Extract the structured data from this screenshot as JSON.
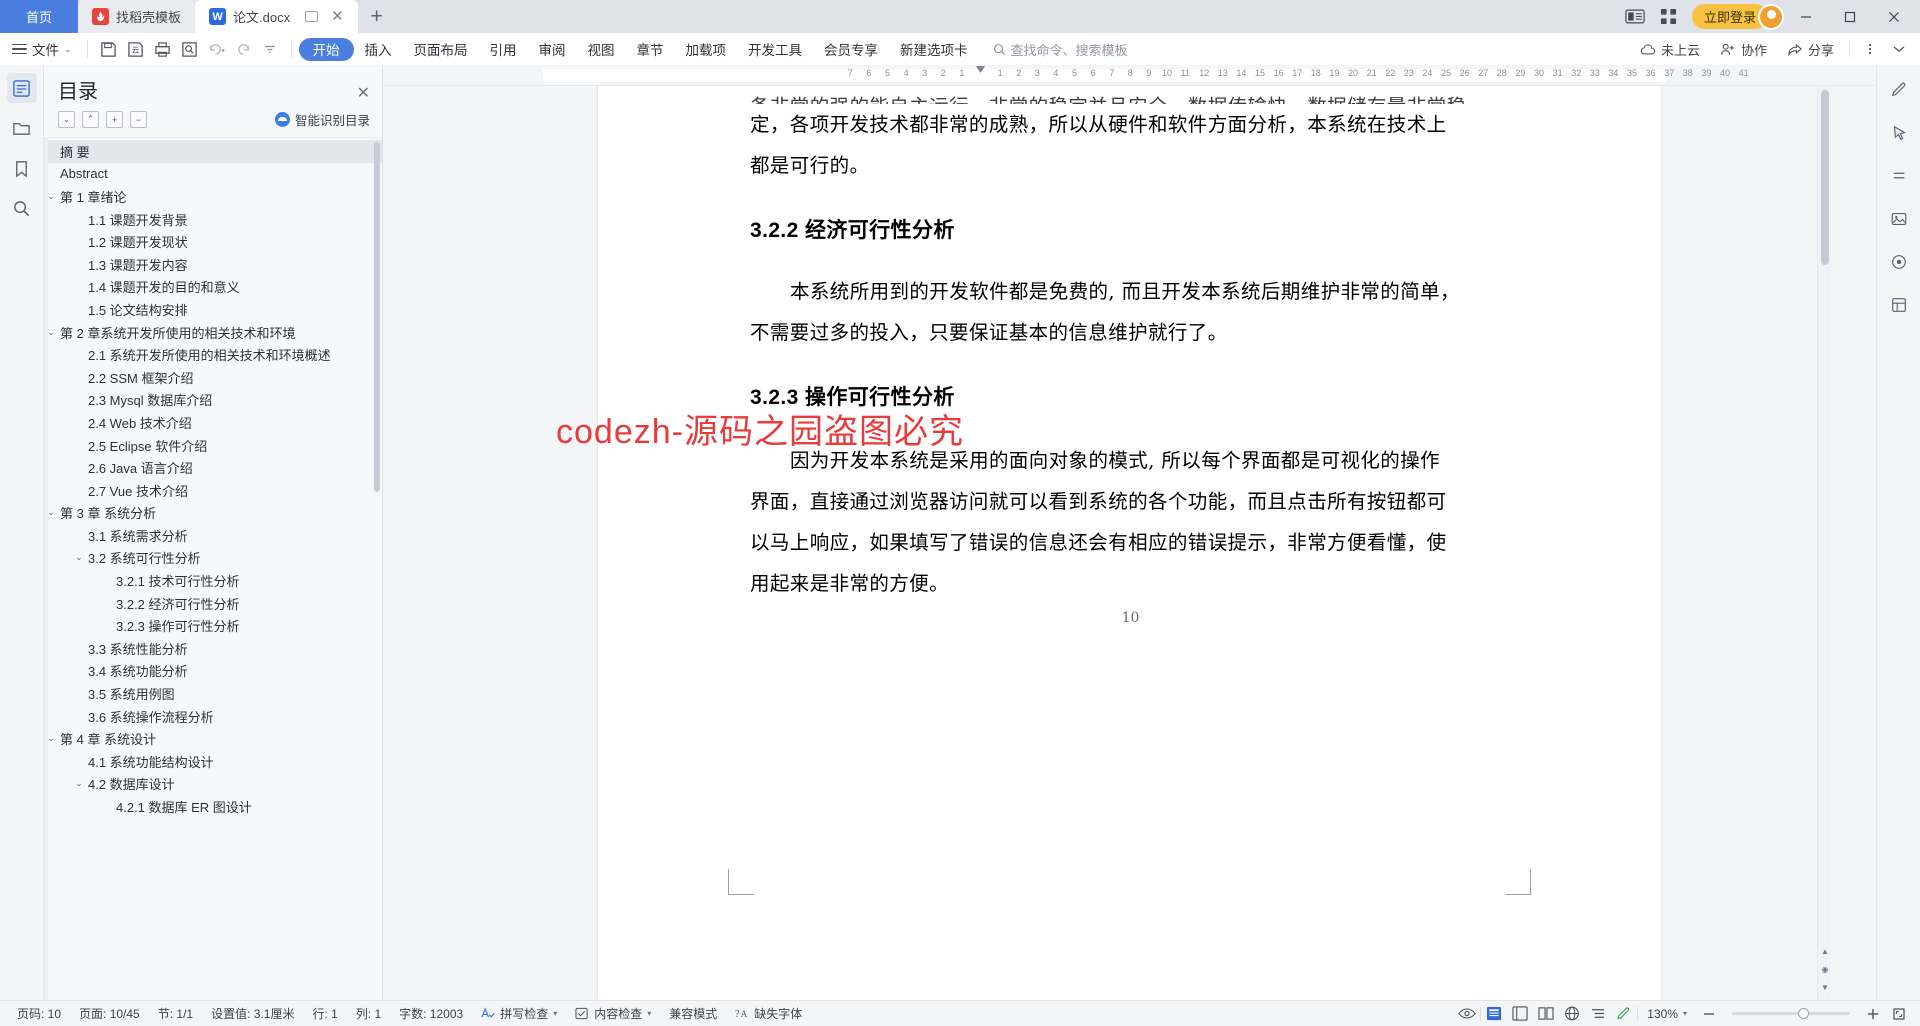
{
  "titlebar": {
    "tabs": [
      {
        "label": "首页",
        "type": "home"
      },
      {
        "label": "找稻壳模板",
        "type": "inactive",
        "icon": "docer-icon"
      },
      {
        "label": "论文.docx",
        "type": "active",
        "icon": "word-icon"
      }
    ],
    "new_tab_label": "+",
    "login_label": "立即登录",
    "window": {
      "minimize": "—",
      "maximize": "▢",
      "close": "✕"
    }
  },
  "ribbon": {
    "file_label": "文件",
    "quick_icons": [
      "save-icon",
      "save-as-icon",
      "print-icon",
      "print-preview-icon",
      "undo-icon",
      "redo-icon"
    ],
    "tabs": [
      {
        "label": "开始",
        "selected": true
      },
      {
        "label": "插入",
        "selected": false
      },
      {
        "label": "页面布局",
        "selected": false
      },
      {
        "label": "引用",
        "selected": false
      },
      {
        "label": "审阅",
        "selected": false
      },
      {
        "label": "视图",
        "selected": false
      },
      {
        "label": "章节",
        "selected": false
      },
      {
        "label": "加载项",
        "selected": false
      },
      {
        "label": "开发工具",
        "selected": false
      },
      {
        "label": "会员专享",
        "selected": false
      },
      {
        "label": "新建选项卡",
        "selected": false
      }
    ],
    "search_placeholder": "查找命令、搜索模板",
    "right_items": [
      {
        "label": "未上云",
        "icon": "cloud-icon"
      },
      {
        "label": "协作",
        "icon": "collaborate-icon"
      },
      {
        "label": "分享",
        "icon": "share-icon"
      }
    ]
  },
  "left_rail": [
    {
      "name": "outline-icon",
      "active": true
    },
    {
      "name": "folder-icon",
      "active": false
    },
    {
      "name": "bookmark-icon",
      "active": false
    },
    {
      "name": "search-icon",
      "active": false
    }
  ],
  "right_rail": [
    {
      "name": "pen-edit-icon"
    },
    {
      "name": "cursor-select-icon"
    },
    {
      "name": "paragraph-icon"
    },
    {
      "name": "image-icon"
    },
    {
      "name": "record-icon"
    },
    {
      "name": "layout-icon"
    }
  ],
  "toc": {
    "title": "目录",
    "close_label": "✕",
    "tools": [
      "collapse-down-button",
      "collapse-up-button",
      "expand-all-button",
      "collapse-all-button"
    ],
    "smart_label": "智能识别目录",
    "items": [
      {
        "label": "摘 要",
        "level": 1,
        "caret": "",
        "selected": true
      },
      {
        "label": "Abstract",
        "level": 1,
        "caret": "",
        "selected": false
      },
      {
        "label": "第 1 章绪论",
        "level": 1,
        "caret": "down",
        "selected": false
      },
      {
        "label": "1.1 课题开发背景",
        "level": 2,
        "caret": "",
        "selected": false
      },
      {
        "label": "1.2 课题开发现状",
        "level": 2,
        "caret": "",
        "selected": false
      },
      {
        "label": "1.3 课题开发内容",
        "level": 2,
        "caret": "",
        "selected": false
      },
      {
        "label": "1.4 课题开发的目的和意义",
        "level": 2,
        "caret": "",
        "selected": false
      },
      {
        "label": "1.5 论文结构安排",
        "level": 2,
        "caret": "",
        "selected": false
      },
      {
        "label": "第 2 章系统开发所使用的相关技术和环境",
        "level": 1,
        "caret": "down",
        "selected": false
      },
      {
        "label": "2.1 系统开发所使用的相关技术和环境概述",
        "level": 2,
        "caret": "",
        "selected": false
      },
      {
        "label": "2.2 SSM 框架介绍",
        "level": 2,
        "caret": "",
        "selected": false
      },
      {
        "label": "2.3 Mysql 数据库介绍",
        "level": 2,
        "caret": "",
        "selected": false
      },
      {
        "label": "2.4 Web 技术介绍",
        "level": 2,
        "caret": "",
        "selected": false
      },
      {
        "label": "2.5 Eclipse 软件介绍",
        "level": 2,
        "caret": "",
        "selected": false
      },
      {
        "label": "2.6 Java 语言介绍",
        "level": 2,
        "caret": "",
        "selected": false
      },
      {
        "label": "2.7 Vue 技术介绍",
        "level": 2,
        "caret": "",
        "selected": false
      },
      {
        "label": "第 3 章 系统分析",
        "level": 1,
        "caret": "down",
        "selected": false
      },
      {
        "label": "3.1 系统需求分析",
        "level": 2,
        "caret": "",
        "selected": false
      },
      {
        "label": "3.2 系统可行性分析",
        "level": 2,
        "caret": "down",
        "selected": false
      },
      {
        "label": "3.2.1 技术可行性分析",
        "level": 3,
        "caret": "",
        "selected": false
      },
      {
        "label": "3.2.2 经济可行性分析",
        "level": 3,
        "caret": "",
        "selected": false
      },
      {
        "label": "3.2.3 操作可行性分析",
        "level": 3,
        "caret": "",
        "selected": false
      },
      {
        "label": "3.3 系统性能分析",
        "level": 2,
        "caret": "",
        "selected": false
      },
      {
        "label": "3.4  系统功能分析",
        "level": 2,
        "caret": "",
        "selected": false
      },
      {
        "label": "3.5 系统用例图",
        "level": 2,
        "caret": "",
        "selected": false
      },
      {
        "label": "3.6 系统操作流程分析",
        "level": 2,
        "caret": "",
        "selected": false
      },
      {
        "label": "第 4 章 系统设计",
        "level": 1,
        "caret": "down",
        "selected": false
      },
      {
        "label": "4.1 系统功能结构设计",
        "level": 2,
        "caret": "",
        "selected": false
      },
      {
        "label": "4.2 数据库设计",
        "level": 2,
        "caret": "down",
        "selected": false
      },
      {
        "label": "4.2.1 数据库 ER 图设计",
        "level": 3,
        "caret": "",
        "selected": false
      }
    ]
  },
  "ruler": {
    "left_ticks": [
      "7",
      "6",
      "5",
      "4",
      "3",
      "2",
      "1"
    ],
    "right_ticks": [
      "1",
      "2",
      "3",
      "4",
      "5",
      "6",
      "7",
      "8",
      "9",
      "10",
      "11",
      "12",
      "13",
      "14",
      "15",
      "16",
      "17",
      "18",
      "19",
      "20",
      "21",
      "22",
      "23",
      "24",
      "25",
      "26",
      "27",
      "28",
      "29",
      "30",
      "31",
      "32",
      "33",
      "34",
      "35",
      "36",
      "37",
      "38",
      "39",
      "40",
      "41"
    ]
  },
  "document": {
    "paragraphs": [
      {
        "text": "定，各项开发技术都非常的成熟，所以从硬件和软件方面分析，本系统在技术上",
        "type": "body"
      },
      {
        "text": "都是可行的。",
        "type": "body"
      },
      {
        "text": "3.2.2 经济可行性分析",
        "type": "h3"
      },
      {
        "text": "本系统所用到的开发软件都是免费的, 而且开发本系统后期维护非常的简单，",
        "type": "body-indent"
      },
      {
        "text": "不需要过多的投入，只要保证基本的信息维护就行了。",
        "type": "body"
      },
      {
        "text": "3.2.3 操作可行性分析",
        "type": "h3"
      },
      {
        "text": "因为开发本系统是采用的面向对象的模式, 所以每个界面都是可视化的操作",
        "type": "body-indent"
      },
      {
        "text": "界面，直接通过浏览器访问就可以看到系统的各个功能，而且点击所有按钮都可",
        "type": "body"
      },
      {
        "text": "以马上响应，如果填写了错误的信息还会有相应的错误提示，非常方便看懂，使",
        "type": "body"
      },
      {
        "text": "用起来是非常的方便。",
        "type": "body"
      }
    ],
    "top_clipped_text": "备非常的强的能自主运行，非常的稳定并且安全，数据传输快，数据储存量非常稳",
    "watermark": "codezh-源码之园盗图必究",
    "watermark_color": "#ea3a3a",
    "page_number": "10"
  },
  "status": {
    "left_items": [
      {
        "label": "页码: 10"
      },
      {
        "label": "页面: 10/45"
      },
      {
        "label": "节: 1/1"
      },
      {
        "label": "设置值: 3.1厘米"
      },
      {
        "label": "行: 1"
      },
      {
        "label": "列: 1"
      },
      {
        "label": "字数: 12003"
      }
    ],
    "spell_check": "拼写检查",
    "content_check": "内容检查",
    "compat_mode": "兼容模式",
    "missing_font": "缺失字体",
    "zoom_label": "130%",
    "zoom_out": "—",
    "zoom_in": "+",
    "view_icons": [
      "eye-icon",
      "print-layout-icon",
      "full-screen-icon",
      "reading-layout-icon",
      "web-layout-icon",
      "outline-view-icon",
      "annotate-icon"
    ]
  },
  "colors": {
    "accent": "#4a7fe0",
    "login": "#f7c242",
    "watermark": "#ea3a3a",
    "toc_selected": "#e3e6ec"
  }
}
